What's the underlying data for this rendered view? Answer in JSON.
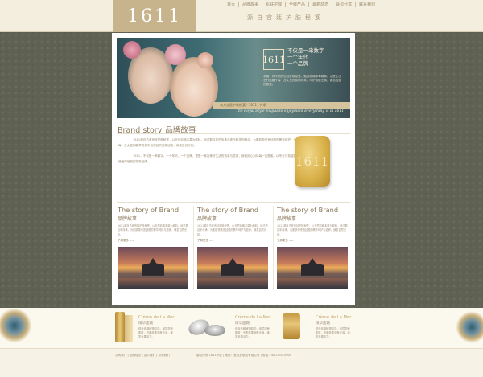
{
  "header": {
    "logo": "1611",
    "nav": [
      "首页",
      "品牌故事",
      "肌肤护理",
      "全线产品",
      "最新动态",
      "会员分享",
      "联系我们"
    ],
    "tagline": "源自宫廷护肤秘笈"
  },
  "banner": {
    "logo": "1611",
    "slogan": [
      "不仅是一串数字",
      "一个年代",
      "一个品牌"
    ],
    "desc": "承袭一种不朽的宫廷护肤秘笈，甄选珍稀本草精粹，以匠心工艺打造属于每一位女性的美丽传奇，呵护肌肤之美，源自宫廷的奢宠。",
    "strip": "东方宫廷护肤秘笈 · 1611 · 传承",
    "script": "The Royal Style Exquisite enjoyment Everything is in 1611"
  },
  "brand_story": {
    "title_en": "Brand story",
    "title_cn": "品牌故事",
    "paragraphs": [
      "1611源自古老宫廷护肤秘笈，以天然珍稀本草为原料，经过数百年的传承与现代科技的融合，为肌肤带来宫廷般的奢华呵护，让每一位女性都能享受到来自宫廷的美丽秘密，焕发自然光彩。",
      "1611，不仅是一串数字，一个年代，一个品牌，更是一种对美好生活的追求与坚持，我们用心对待每一位顾客，以专业与真诚打造值得信赖的护肤品牌。"
    ],
    "soap_label": "1611"
  },
  "columns": [
    {
      "title_en": "The  story of Brand",
      "title_cn": "品牌故事",
      "text": "1611源自古老宫廷护肤秘笈，以天然珍稀本草为原料，经过数百年传承，为肌肤带来宫廷般的奢华呵护与滋养，焕发自然光彩。",
      "more": "了解更多 >>"
    },
    {
      "title_en": "The  story of Brand",
      "title_cn": "品牌故事",
      "text": "1611源自古老宫廷护肤秘笈，以天然珍稀本草为原料，经过数百年传承，为肌肤带来宫廷般的奢华呵护与滋养，焕发自然光彩。",
      "more": "了解更多 >>"
    },
    {
      "title_en": "The  story of Brand",
      "title_cn": "品牌故事",
      "text": "1611源自古老宫廷护肤秘笈，以天然珍稀本草为原料，经过数百年传承，为肌肤带来宫廷般的奢华呵护与滋养，焕发自然光彩。",
      "more": "了解更多 >>"
    }
  ],
  "products": [
    {
      "title": "Crème de La Mer",
      "sub": "精华面霜",
      "desc": "蕴含珍稀植物精华，深层滋养肌肤，令肌肤柔润有光泽，焕发青春活力。"
    },
    {
      "title": "Crème de La Mer",
      "sub": "精华面霜",
      "desc": "蕴含珍稀植物精华，深层滋养肌肤，令肌肤柔润有光泽，焕发青春活力。"
    },
    {
      "title": "Crème de La Mer",
      "sub": "精华面霜",
      "desc": "蕴含珍稀植物精华，深层滋养肌肤，令肌肤柔润有光泽，焕发青春活力。"
    }
  ],
  "footer": {
    "left": "公司简介 | 品牌理念 | 加入我们 | 联系我们",
    "right": "版权所有 1611护肤 | 地址：宫廷护肤品有限公司 | 电话：400-000-0000"
  }
}
